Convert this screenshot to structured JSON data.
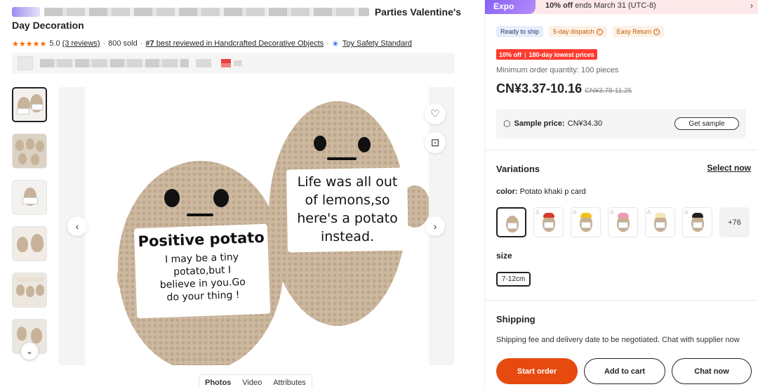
{
  "product": {
    "title_tail": "Parties Valentine's",
    "title_line2": "Day Decoration",
    "rating": "5.0",
    "reviews": "(3 reviews)",
    "sold": "800 sold",
    "rank_prefix": "#7",
    "rank_text": "best reviewed in Handcrafted Decorative Objects",
    "safety": "Toy Safety Standard"
  },
  "media": {
    "tabs": [
      "Photos",
      "Video",
      "Attributes"
    ],
    "photo": {
      "left_sign": [
        "Positive potato",
        "I may be a tiny",
        "potato,but I",
        "believe in you.Go",
        "do your thing !"
      ],
      "right_sign": [
        "Life was all out",
        "of lemons,so",
        "here's a potato",
        "instead."
      ]
    }
  },
  "promo": {
    "badge": "Expo",
    "text_bold": "10% off",
    "text_rest": "ends March 31 (UTC-8)"
  },
  "badges": {
    "ready": "Ready to ship",
    "dispatch": "5-day dispatch",
    "easy_return": "Easy Return"
  },
  "discount": {
    "off": "10% off",
    "lowest": "180-day lowest prices"
  },
  "pricing": {
    "moq": "Minimum order quantity: 100 pieces",
    "price": "CN¥3.37-10.16",
    "old_price": "CN¥3.78-11.25",
    "sample_label": "Sample price:",
    "sample_value": "CN¥34.30",
    "sample_button": "Get sample"
  },
  "variations": {
    "title": "Variations",
    "select_now": "Select now",
    "color_label": "color:",
    "color_value": "Potato khaki p card",
    "more_count": "+76",
    "size_label": "size",
    "size_value": "7-12cm"
  },
  "shipping": {
    "title": "Shipping",
    "text": "Shipping fee and delivery date to be negotiated. Chat with supplier now"
  },
  "actions": {
    "start_order": "Start order",
    "add_to_cart": "Add to cart",
    "chat_now": "Chat now"
  },
  "colors": {
    "accent": "#e64a0f",
    "discount_red": "#ff3b2f",
    "star": "#ff6a00"
  }
}
